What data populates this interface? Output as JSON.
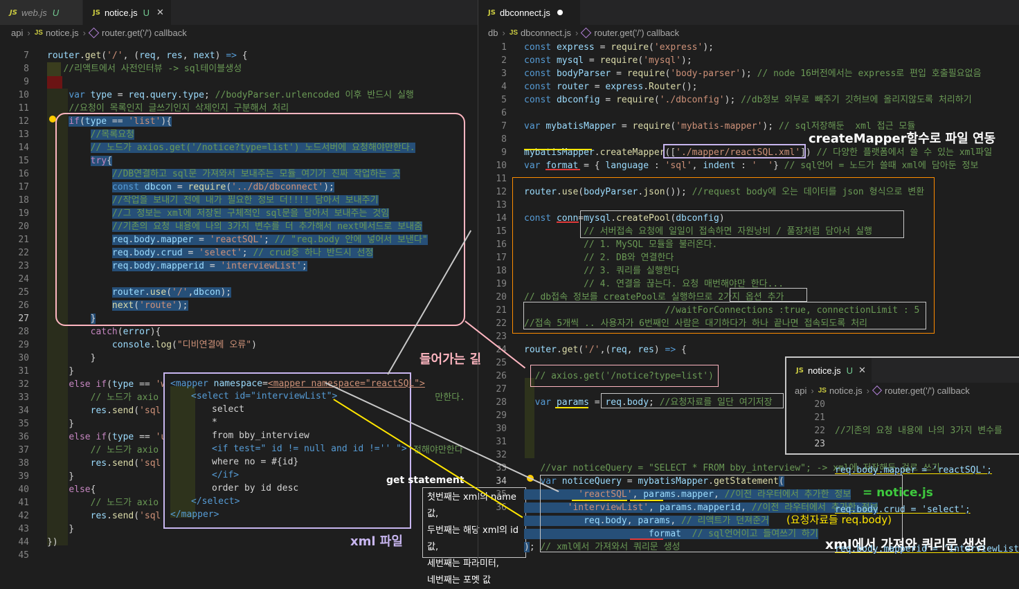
{
  "left_tabs": [
    {
      "label": "web.js",
      "badge": "U"
    },
    {
      "label": "notice.js",
      "badge": "U"
    }
  ],
  "left_crumb": [
    "api",
    "notice.js",
    "router.get('/') callback"
  ],
  "right_tabs": [
    {
      "label": "dbconnect.js"
    }
  ],
  "right_crumb": [
    "db",
    "dbconnect.js",
    "router.get('/') callback"
  ],
  "left_lines": [
    "7",
    "8",
    "9",
    "10",
    "11",
    "12",
    "13",
    "14",
    "15",
    "16",
    "17",
    "18",
    "19",
    "20",
    "21",
    "22",
    "23",
    "24",
    "25",
    "26",
    "27",
    "28",
    "29",
    "30",
    "31",
    "32",
    "33",
    "34",
    "35",
    "36",
    "37",
    "38",
    "39",
    "40",
    "41",
    "42",
    "43",
    "44",
    "45"
  ],
  "right_lines": [
    "1",
    "2",
    "3",
    "4",
    "5",
    "6",
    "7",
    "8",
    "9",
    "10",
    "11",
    "12",
    "13",
    "14",
    "15",
    "16",
    "17",
    "18",
    "19",
    "20",
    "21",
    "22",
    "23",
    "24",
    "25",
    "26",
    "27",
    "28",
    "29",
    "30",
    "31",
    "32",
    "33",
    "34",
    "35",
    "36"
  ],
  "popup": {
    "tab": "notice.js",
    "badge": "U",
    "crumb": [
      "api",
      "notice.js",
      "router.get('/') callback"
    ],
    "lines": [
      "20",
      "21",
      "22",
      "23"
    ],
    "code": [
      "//기존의 요청 내용에 나의 3가지 변수를",
      "req.body.mapper = 'reactSQL';",
      "req.body.crud = 'select';",
      "req.body.mapperid = 'interviewList';"
    ]
  },
  "xml": {
    "lines": [
      "<mapper namespace=\"reactSQL\">",
      "<select id=\"interviewList\">",
      "select",
      "*",
      "from bby_interview",
      "<if test=\" id != null and id !='' \">",
      "where no = #{id}",
      "</if>",
      "order by id desc",
      "</select>",
      "</mapper>"
    ]
  },
  "notes": {
    "items": [
      "첫번째는 xml의 name값,",
      "두번째는 해당 xml의 id값,",
      "세번째는 파라미터,",
      "네번째는 포멧 값"
    ]
  },
  "annotations": {
    "create_mapper": "createMapper함수로 파일 연동",
    "path": "들어가는 길",
    "get_statement": "get  statement",
    "xml_file": "xml 파일",
    "notice_js": "= notice.js",
    "req_body": "(요청자료들 req.body)",
    "xml_query": "xml에서 가져와 쿼리문 생성"
  },
  "colors": {
    "pink": "#ffb6c1",
    "lavender": "#c8b6f0",
    "orange": "#ff8c00",
    "green": "#3ec93e",
    "yellow": "#ffe600",
    "red": "#e23a3a"
  }
}
